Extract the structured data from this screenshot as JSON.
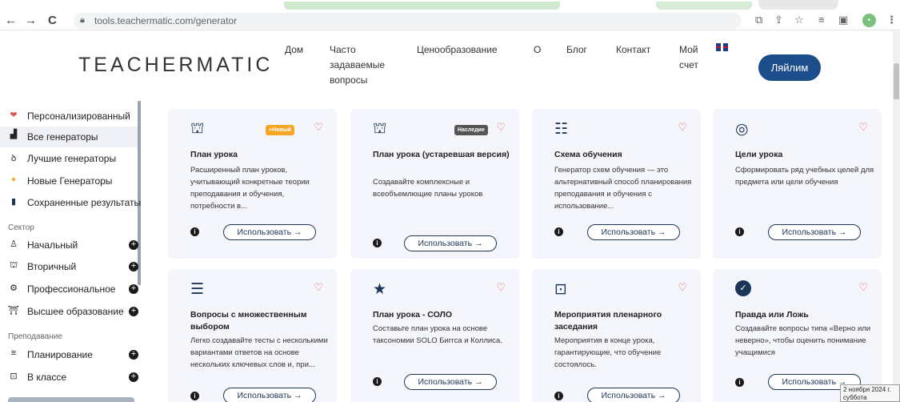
{
  "browser": {
    "back": "←",
    "forward": "→",
    "reload": "C",
    "url": "tools.teachermatic.com/generator",
    "avatar_letter": "•"
  },
  "site": {
    "logo": "TEACHERMATIC",
    "menu": [
      {
        "label": "Дом"
      },
      {
        "label": "Часто задаваемые вопросы"
      },
      {
        "label": "Ценообразование"
      },
      {
        "label": "О"
      },
      {
        "label": "Блог"
      },
      {
        "label": "Контакт"
      },
      {
        "label": "Мой счет"
      }
    ],
    "login_label": "Ляйлим"
  },
  "sidebar": {
    "items": [
      {
        "label": "Персонализированный",
        "icon": "heart-icon",
        "glyph": "❤",
        "color": "#e5534b"
      },
      {
        "label": "Все генераторы",
        "icon": "grid-icon",
        "glyph": "▟"
      },
      {
        "label": "Лучшие генераторы",
        "icon": "trophy-icon",
        "glyph": "ꝺ"
      },
      {
        "label": "Новые Генераторы",
        "icon": "sparkle-icon",
        "glyph": "✦",
        "color": "#f5a623"
      },
      {
        "label": "Сохраненные результаты",
        "icon": "bookmark-icon",
        "glyph": "▮"
      }
    ],
    "sector_title": "Сектор",
    "sector_items": [
      {
        "label": "Начальный",
        "icon": "child-icon",
        "glyph": "♙"
      },
      {
        "label": "Вторичный",
        "icon": "teacher-icon",
        "glyph": "⛫"
      },
      {
        "label": "Профессиональное",
        "icon": "gear-icon",
        "glyph": "⚙"
      },
      {
        "label": "Высшее образование",
        "icon": "graduation-icon",
        "glyph": "⛩"
      }
    ],
    "teaching_title": "Преподавание",
    "teaching_items": [
      {
        "label": "Планирование",
        "icon": "planning-icon",
        "glyph": "≡"
      },
      {
        "label": "В классе",
        "icon": "classroom-icon",
        "glyph": "⊡"
      }
    ],
    "plus_glyph": "+"
  },
  "cards": [
    {
      "title": "План урока",
      "desc": "Расширенный план уроков, учитывающий конкретные теории преподавания и обучения, потребности в...",
      "badge": "+Новый",
      "icon": "teacher-board-icon",
      "glyph": "⛫",
      "use": "Использовать →"
    },
    {
      "title": "План урока (устаревшая версия)",
      "desc": "Создавайте комплексные и всеобъемлющие планы уроков",
      "badge": "Наследие",
      "icon": "teacher-board-icon",
      "glyph": "⛫",
      "use": "Использовать →"
    },
    {
      "title": "Схема обучения",
      "desc": "Генератор схем обучения — это альтернативный способ планирования преподавания и обучения с использование...",
      "icon": "list-icon",
      "glyph": "☷",
      "use": "Использовать →"
    },
    {
      "title": "Цели урока",
      "desc": "Сформировать ряд учебных целей для предмета или цели обучения",
      "icon": "target-icon",
      "glyph": "◎",
      "use": "Использовать →"
    },
    {
      "title": "Вопросы с множественным выбором",
      "desc": "Легко создавайте тесты с несколькими вариантами ответов на основе нескольких ключевых слов и, при...",
      "icon": "checklist-icon",
      "glyph": "☰",
      "use": "Использовать →"
    },
    {
      "title": "План урока - СОЛО",
      "desc": "Составьте план урока на основе таксономии SOLO Биггса и Коллиса.",
      "icon": "star-icon",
      "glyph": "★",
      "use": "Использовать →"
    },
    {
      "title": "Мероприятия пленарного заседания",
      "desc": "Мероприятия в конце урока, гарантирующие, что обучение состоялось.",
      "icon": "presentation-icon",
      "glyph": "⊡",
      "use": "Использовать →"
    },
    {
      "title": "Правда или Ложь",
      "desc": "Создавайте вопросы типа «Верно или неверно», чтобы оценить понимание учащимися",
      "icon": "check-circle-icon",
      "glyph": "✓",
      "use": "Использовать →"
    }
  ],
  "tooltip": {
    "date": "2 ноября 2024 г.",
    "weekday": "суббота"
  },
  "colors": {
    "brand": "#1c4e8c",
    "card_bg": "#f4f6fb",
    "heart": "#e5534b",
    "badge_new": "#f5a623",
    "badge_legacy": "#555555"
  }
}
